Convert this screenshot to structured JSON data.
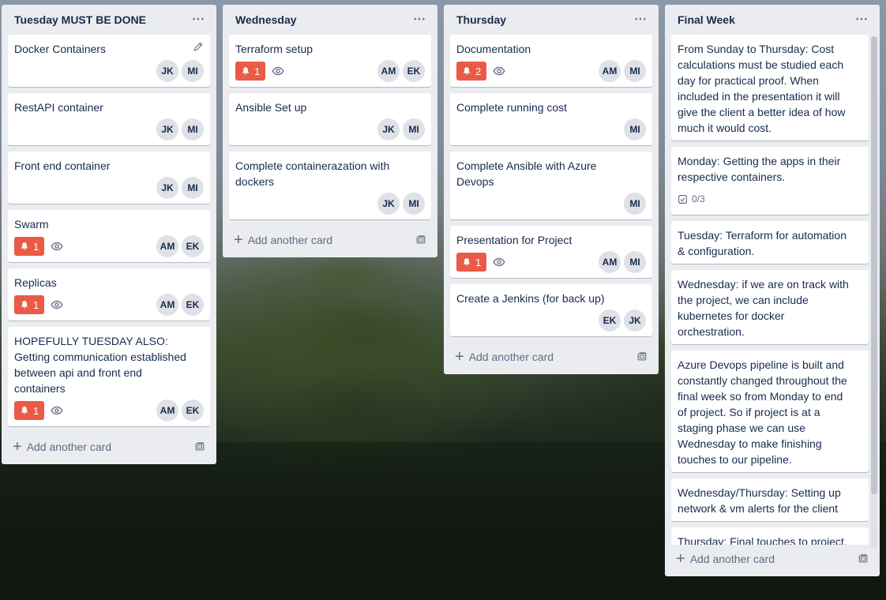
{
  "lists": [
    {
      "title": "Tuesday MUST BE DONE",
      "cards": [
        {
          "title": "Docker Containers",
          "members": [
            "JK",
            "MI"
          ]
        },
        {
          "title": "RestAPI container",
          "members": [
            "JK",
            "MI"
          ]
        },
        {
          "title": "Front end container",
          "members": [
            "JK",
            "MI"
          ]
        },
        {
          "title": "Swarm",
          "alert_count": "1",
          "members": [
            "AM",
            "EK"
          ]
        },
        {
          "title": "Replicas",
          "alert_count": "1",
          "members": [
            "AM",
            "EK"
          ]
        },
        {
          "title": "HOPEFULLY TUESDAY ALSO: Getting communication established between api and front end containers",
          "alert_count": "1",
          "members": [
            "AM",
            "EK"
          ]
        }
      ],
      "add_label": "Add another card"
    },
    {
      "title": "Wednesday",
      "cards": [
        {
          "title": "Terraform setup",
          "alert_count": "1",
          "members": [
            "AM",
            "EK"
          ]
        },
        {
          "title": "Ansible Set up",
          "members": [
            "JK",
            "MI"
          ]
        },
        {
          "title": "Complete containerazation with dockers",
          "members": [
            "JK",
            "MI"
          ]
        }
      ],
      "add_label": "Add another card"
    },
    {
      "title": "Thursday",
      "cards": [
        {
          "title": "Documentation",
          "alert_count": "2",
          "members": [
            "AM",
            "MI"
          ]
        },
        {
          "title": "Complete running cost",
          "members": [
            "MI"
          ]
        },
        {
          "title": "Complete Ansible with Azure Devops",
          "members": [
            "MI"
          ]
        },
        {
          "title": "Presentation for Project",
          "alert_count": "1",
          "members": [
            "AM",
            "MI"
          ]
        },
        {
          "title": "Create a Jenkins (for back up)",
          "members": [
            "EK",
            "JK"
          ]
        }
      ],
      "add_label": "Add another card"
    },
    {
      "title": "Final Week",
      "cards": [
        {
          "title": "From Sunday to Thursday: Cost calculations must be studied each day for practical proof. When included in the presentation it will give the client a better idea of how much it would cost."
        },
        {
          "title": "Monday: Getting the apps in their respective containers.",
          "checklist": "0/3"
        },
        {
          "title": "Tuesday: Terraform for automation & configuration."
        },
        {
          "title": "Wednesday: if we are on track with the project, we can include kubernetes for docker orchestration."
        },
        {
          "title": "Azure Devops pipeline is built and constantly changed throughout the final week so from Monday to end of project. So if project is at a staging phase we can use Wednesday to make finishing touches to our pipeline."
        },
        {
          "title": "Wednesday/Thursday: Setting up network & vm alerts for the client"
        },
        {
          "title": "Thursday: Final touches to project. This means overviewing everything we have done"
        }
      ],
      "add_label": "Add another card"
    }
  ],
  "icons": {
    "list_menu": "⋯",
    "plus": "+"
  },
  "colors": {
    "alert_badge": "#eb5a46",
    "list_bg": "#ebecf0",
    "text": "#172b4d"
  }
}
